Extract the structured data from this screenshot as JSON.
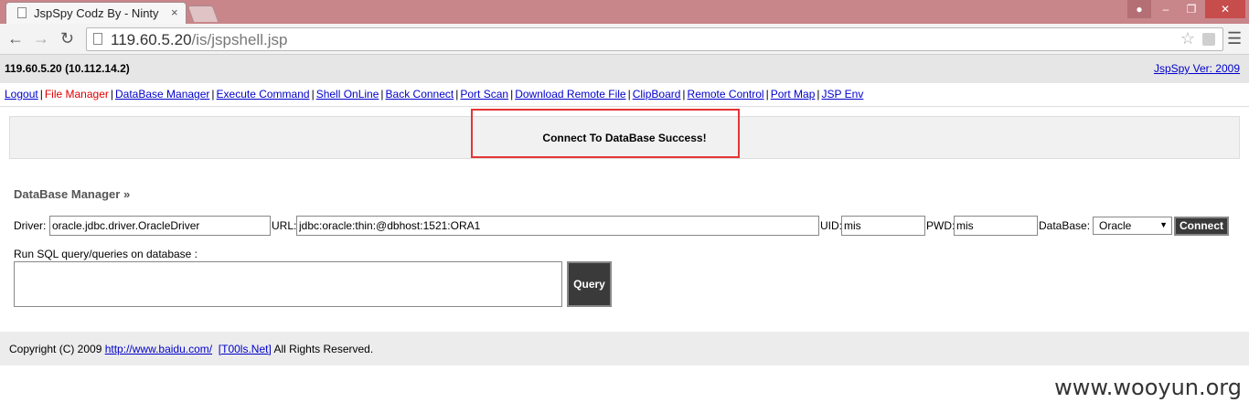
{
  "browser": {
    "tab_title": "JspSpy Codz By - Ninty",
    "tab_close": "×",
    "url_host": "119.60.5.20",
    "url_path": "/is/jspshell.jsp",
    "back_icon": "arrow-left-icon",
    "forward_icon": "arrow-right-icon",
    "reload_icon": "reload-icon",
    "star_icon": "star-icon",
    "menu_icon": "hamburger-menu-icon"
  },
  "header": {
    "host": "119.60.5.20 (10.112.14.2)",
    "version_link": "JspSpy Ver: 2009"
  },
  "nav": [
    {
      "label": "Logout"
    },
    {
      "label": "File Manager",
      "active": true
    },
    {
      "label": "DataBase Manager"
    },
    {
      "label": "Execute Command"
    },
    {
      "label": "Shell OnLine"
    },
    {
      "label": "Back Connect"
    },
    {
      "label": "Port Scan"
    },
    {
      "label": "Download Remote File"
    },
    {
      "label": "ClipBoard"
    },
    {
      "label": "Remote Control"
    },
    {
      "label": "Port Map"
    },
    {
      "label": "JSP Env"
    }
  ],
  "message": "Connect To DataBase Success!",
  "db": {
    "title": "DataBase Manager »",
    "driver_label": "Driver:",
    "driver_value": "oracle.jdbc.driver.OracleDriver",
    "url_label": "URL:",
    "url_value": "jdbc:oracle:thin:@dbhost:1521:ORA1",
    "uid_label": "UID:",
    "uid_value": "mis",
    "pwd_label": "PWD:",
    "pwd_value": "mis",
    "database_label": "DataBase:",
    "database_selected": "Oracle",
    "connect_button": "Connect",
    "sql_label": "Run SQL query/queries on database :",
    "sql_value": "",
    "query_button": "Query"
  },
  "footer": {
    "prefix": "Copyright (C) 2009 ",
    "link1": "http://www.baidu.com/",
    "link2": "[T00ls.Net]",
    "suffix": " All Rights Reserved."
  },
  "watermark": "www.wooyun.org",
  "colors": {
    "accent_red": "#e53535",
    "link": "#0000cc",
    "titlebar": "#c8858a"
  }
}
